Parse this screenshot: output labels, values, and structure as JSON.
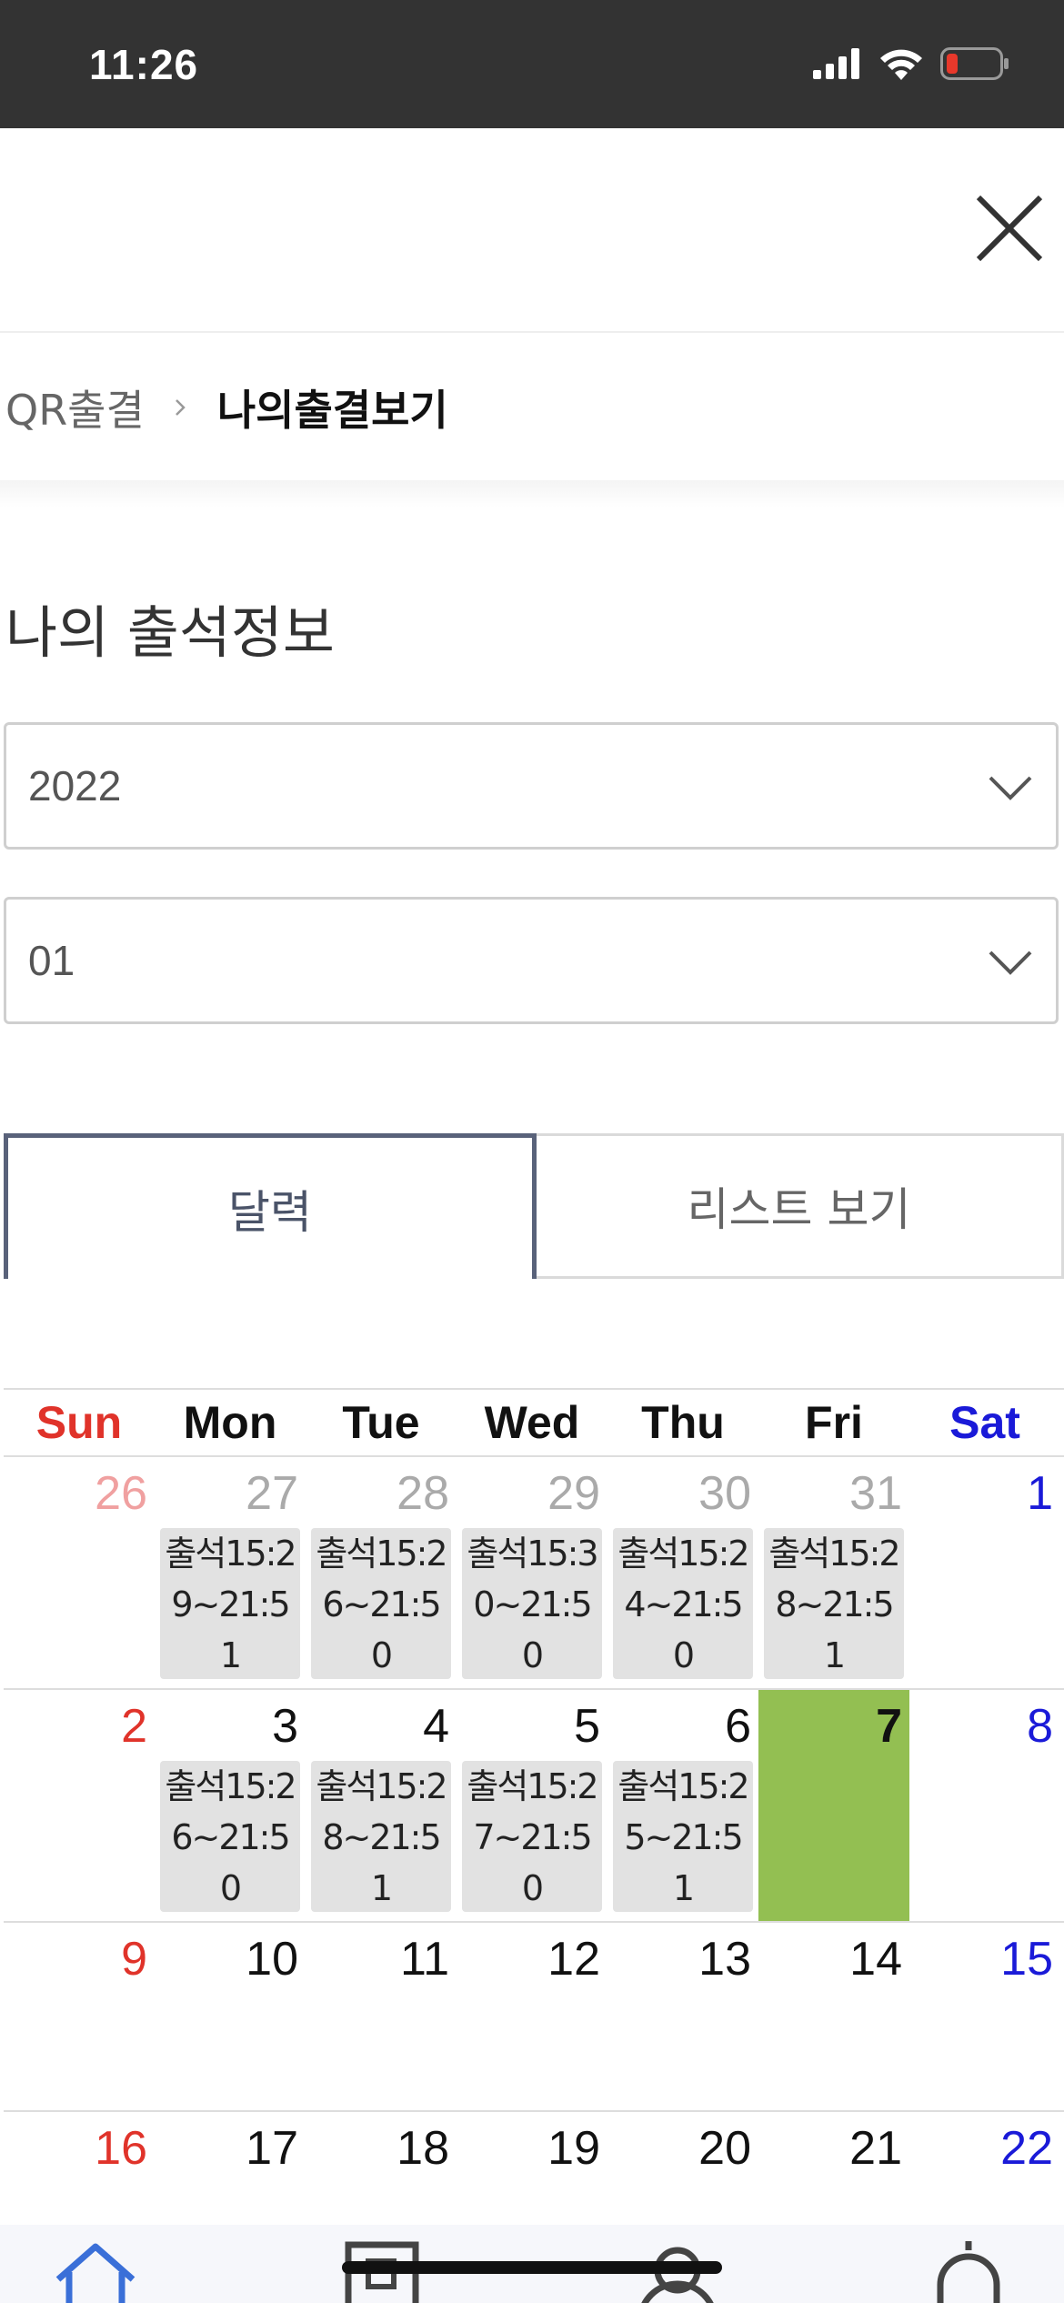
{
  "status_bar": {
    "time": "11:26"
  },
  "breadcrumb": {
    "parent": "QR출결",
    "current": "나의출결보기"
  },
  "page": {
    "title": "나의 출석정보"
  },
  "filters": {
    "year": "2022",
    "month": "01"
  },
  "tabs": {
    "calendar": "달력",
    "list": "리스트 보기"
  },
  "calendar": {
    "weekdays": [
      "Sun",
      "Mon",
      "Tue",
      "Wed",
      "Thu",
      "Fri",
      "Sat"
    ],
    "weeks": [
      {
        "days": [
          {
            "num": "26",
            "entry": ""
          },
          {
            "num": "27",
            "entry": "출석15:29~21:51"
          },
          {
            "num": "28",
            "entry": "출석15:26~21:50"
          },
          {
            "num": "29",
            "entry": "출석15:30~21:50"
          },
          {
            "num": "30",
            "entry": "출석15:24~21:50"
          },
          {
            "num": "31",
            "entry": "출석15:28~21:51"
          },
          {
            "num": "1",
            "entry": ""
          }
        ]
      },
      {
        "days": [
          {
            "num": "2",
            "entry": ""
          },
          {
            "num": "3",
            "entry": "출석15:26~21:50"
          },
          {
            "num": "4",
            "entry": "출석15:28~21:51"
          },
          {
            "num": "5",
            "entry": "출석15:27~21:50"
          },
          {
            "num": "6",
            "entry": "출석15:25~21:51"
          },
          {
            "num": "7",
            "entry": ""
          },
          {
            "num": "8",
            "entry": ""
          }
        ]
      },
      {
        "days": [
          {
            "num": "9"
          },
          {
            "num": "10"
          },
          {
            "num": "11"
          },
          {
            "num": "12"
          },
          {
            "num": "13"
          },
          {
            "num": "14"
          },
          {
            "num": "15"
          }
        ]
      },
      {
        "days": [
          {
            "num": "16"
          },
          {
            "num": "17"
          },
          {
            "num": "18"
          },
          {
            "num": "19"
          },
          {
            "num": "20"
          },
          {
            "num": "21"
          },
          {
            "num": "22"
          }
        ]
      }
    ]
  },
  "colors": {
    "today": "#93bf52",
    "sunday": "#e0332a",
    "saturday": "#1a1ad8",
    "active_tab": "#59627a"
  },
  "icons": [
    "cellular-icon",
    "wifi-icon",
    "battery-icon",
    "close-icon",
    "chevron-right-icon",
    "chevron-down-icon",
    "home-icon",
    "qr-icon",
    "person-icon",
    "bell-icon"
  ]
}
